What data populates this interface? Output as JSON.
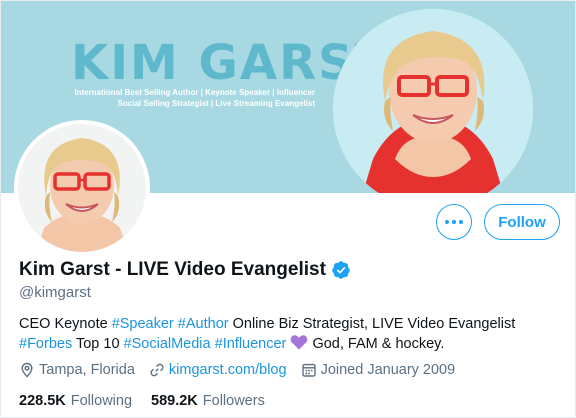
{
  "banner": {
    "name": "KIM GARST",
    "tagline_1": "International Best Selling Author | Keynote Speaker | Influencer",
    "tagline_2": "Social Selling Strategist | Live Streaming Evangelist"
  },
  "actions": {
    "follow_label": "Follow"
  },
  "profile": {
    "display_name": "Kim Garst - LIVE Video Evangelist",
    "handle": "@kimgarst"
  },
  "bio": {
    "t1": "CEO Keynote ",
    "h1": "#Speaker",
    "t2": " ",
    "h2": "#Author",
    "t3": " Online Biz Strategist, LIVE Video Evangelist ",
    "h3": "#Forbes",
    "t4": " Top 10 ",
    "h4": "#SocialMedia",
    "t5": " ",
    "h5": "#Influencer",
    "t6": " ",
    "t7": " God, FAM & hockey."
  },
  "meta": {
    "location": "Tampa, Florida",
    "website": "kimgarst.com/blog",
    "joined": "Joined January 2009"
  },
  "stats": {
    "following_count": "228.5K",
    "following_label": "Following",
    "followers_count": "589.2K",
    "followers_label": "Followers"
  },
  "colors": {
    "accent": "#1da1f2",
    "banner": "#a8d9e2",
    "heart": "#a775d9"
  }
}
